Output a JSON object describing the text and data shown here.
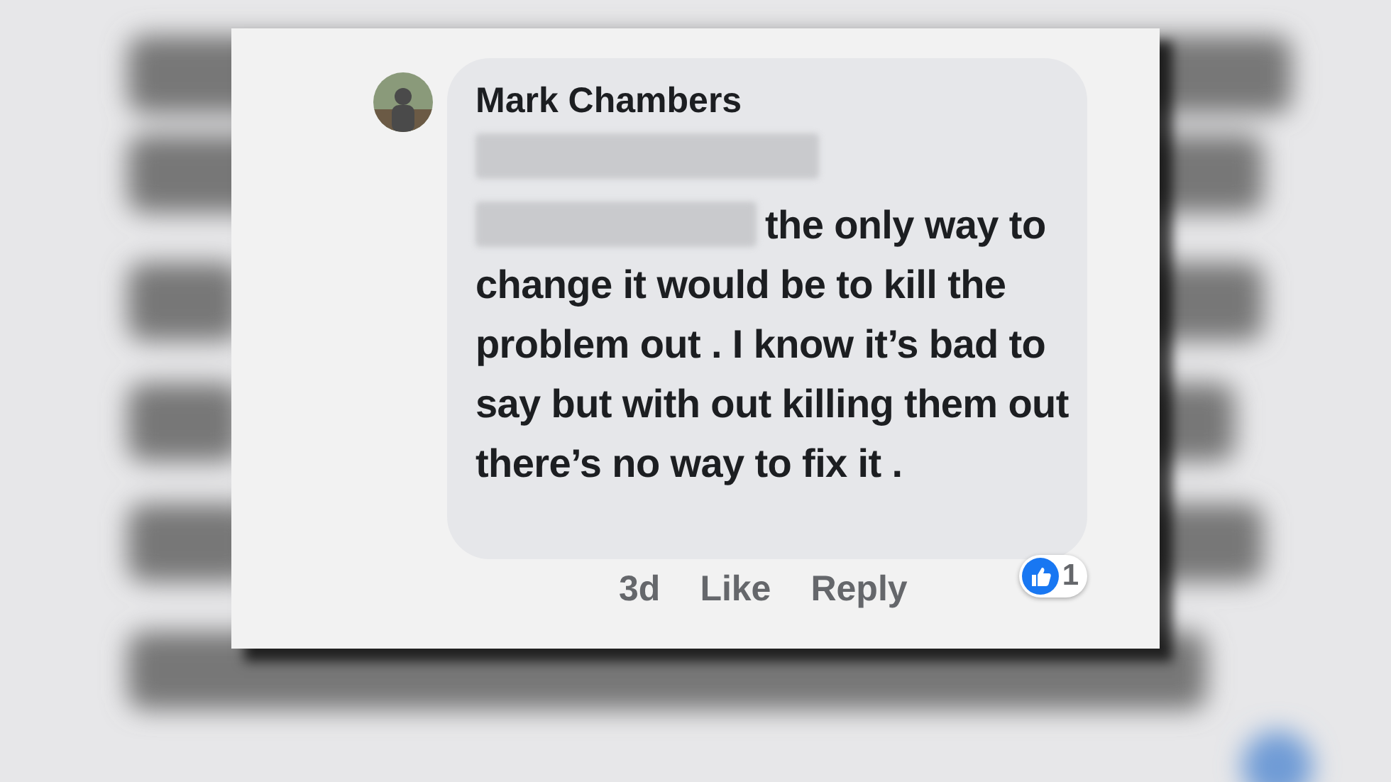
{
  "comment": {
    "author": "Mark Chambers",
    "text": "the only way to change it would be to kill the problem out . I know it’s bad to say but with out killing them out there’s no way to fix it .",
    "age": "3d",
    "actions": [
      "Like",
      "Reply"
    ],
    "reaction_count": "1"
  }
}
